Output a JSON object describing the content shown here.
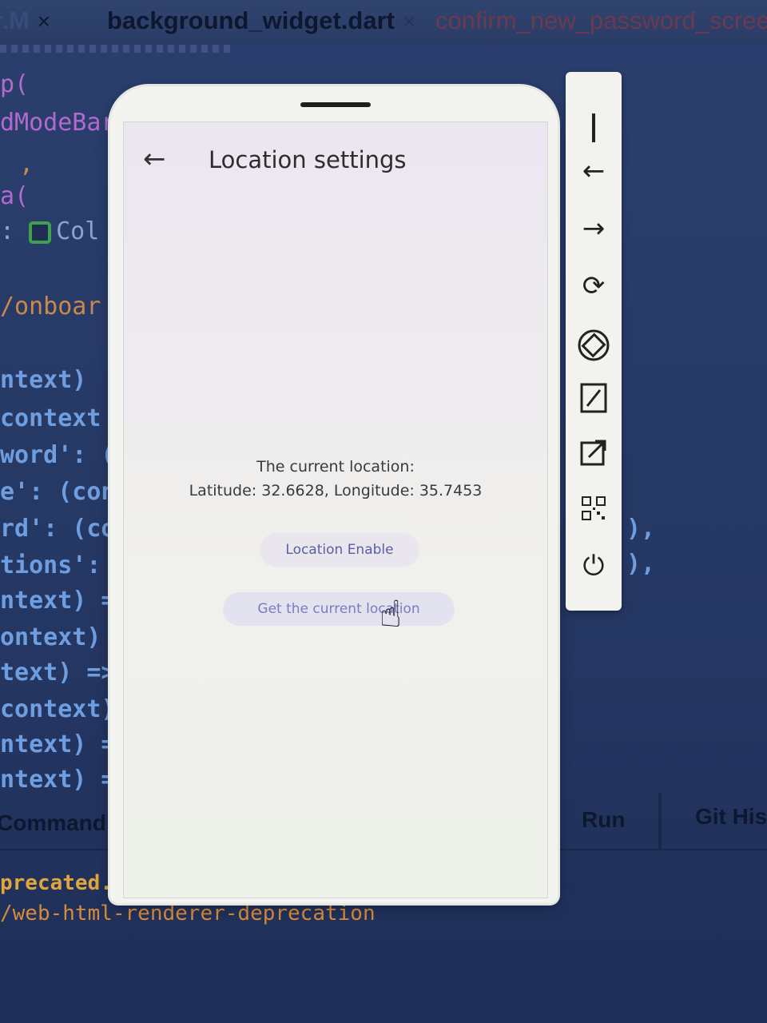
{
  "editor": {
    "tabs": [
      {
        "label": "r.M",
        "close": "×"
      },
      {
        "label": "background_widget.dart",
        "close": "×"
      },
      {
        "label": "confirm_new_password_screen"
      }
    ],
    "code_lines": [
      {
        "text": "p("
      },
      {
        "text": "dModeBar"
      },
      {
        "text": ","
      },
      {
        "text": "a("
      },
      {
        "text": "Col"
      },
      {
        "text": "/onboar"
      },
      {
        "text": "ntext)"
      },
      {
        "text": "context"
      },
      {
        "text": "word': ("
      },
      {
        "text": "e': (con"
      },
      {
        "text": "rd': (co"
      },
      {
        "text": "tions':"
      },
      {
        "text": "ntext) ="
      },
      {
        "text": "ontext)"
      },
      {
        "text": "text) =>"
      },
      {
        "text": "context)"
      },
      {
        "text": "ntext) ="
      },
      {
        "text": "ntext) ="
      }
    ],
    "right_fragments": [
      "),",
      "),"
    ]
  },
  "phone": {
    "appbar_title": "Location settings",
    "current_location_label": "The current location:",
    "current_location_value": "Latitude: 32.6628, Longitude: 35.7453",
    "location_enable_button": "Location Enable",
    "get_location_button": "Get the current location"
  },
  "side_toolbar": {
    "icons": [
      "minimize-icon",
      "back-arrow-icon",
      "forward-arrow-icon",
      "refresh-icon",
      "rotate-icon",
      "edit-icon",
      "open-external-icon",
      "qr-code-icon",
      "power-icon"
    ]
  },
  "bottom_panel": {
    "commands_label": "Commands",
    "run_tab": "Run",
    "git_tab": "Git Hist",
    "output_line_1": "precated. S",
    "output_line_2": "/web-html-renderer-deprecation"
  }
}
